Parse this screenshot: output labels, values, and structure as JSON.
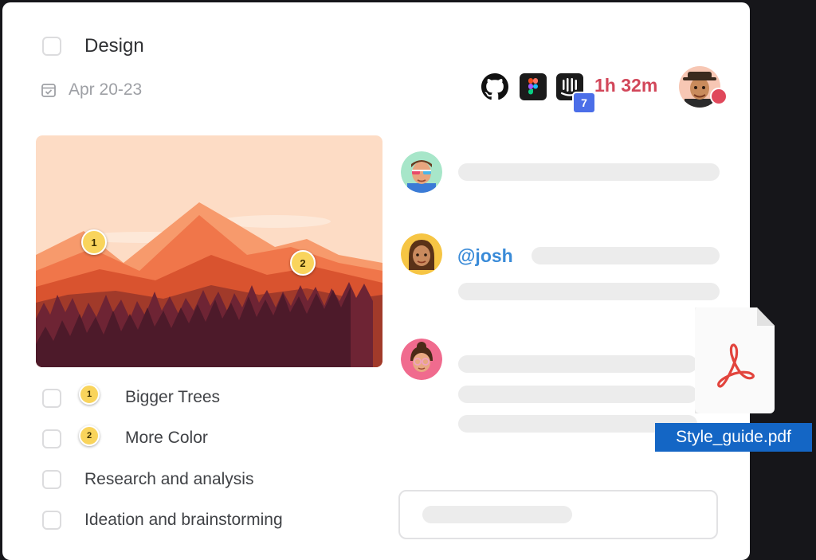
{
  "task": {
    "title": "Design",
    "date": "Apr 20-23"
  },
  "header": {
    "timer": "1h 32m",
    "notification_count": "7",
    "integrations": [
      "github-icon",
      "figma-icon",
      "intercom-icon"
    ]
  },
  "image_markers": [
    "1",
    "2"
  ],
  "checklist": [
    {
      "badge": "1",
      "label": "Bigger Trees"
    },
    {
      "badge": "2",
      "label": "More Color"
    },
    {
      "badge": "",
      "label": "Research and analysis"
    },
    {
      "badge": "",
      "label": "Ideation and brainstorming"
    }
  ],
  "comments": {
    "mention": "@josh"
  },
  "attachment": {
    "file_name": "Style_guide.pdf",
    "icon": "pdf-icon"
  },
  "colors": {
    "timer": "#d2475a",
    "mention": "#3a8bd8",
    "badge": "#f9d45c",
    "file_label": "#1466c5",
    "notification": "#4b6ee8",
    "status_dot": "#e0485b"
  }
}
